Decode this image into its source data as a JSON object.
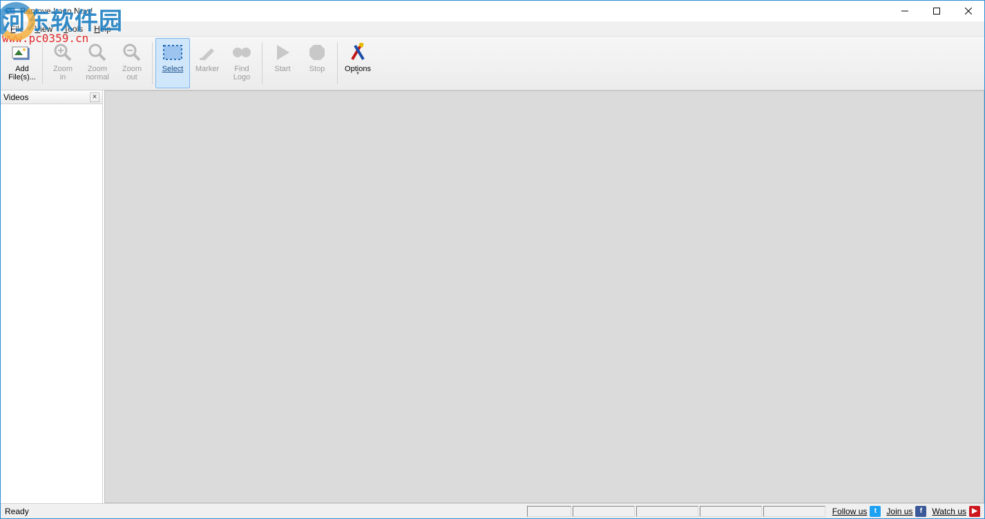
{
  "title": "Remove Logo Now!",
  "menus": {
    "file": "File",
    "view": "View",
    "tools": "Tools",
    "help": "Help"
  },
  "toolbar": {
    "add_files": "Add\nFile(s)...",
    "zoom_in": "Zoom\nin",
    "zoom_normal": "Zoom\nnormal",
    "zoom_out": "Zoom\nout",
    "select": "Select",
    "marker": "Marker",
    "find_logo": "Find\nLogo",
    "start": "Start",
    "stop": "Stop",
    "options": "Options"
  },
  "side_panel": {
    "title": "Videos"
  },
  "status": {
    "text": "Ready"
  },
  "social": {
    "follow": "Follow us",
    "join": "Join us",
    "watch": "Watch us"
  },
  "watermark": {
    "big": "河东软件园",
    "url": "www.pc0359.cn"
  }
}
